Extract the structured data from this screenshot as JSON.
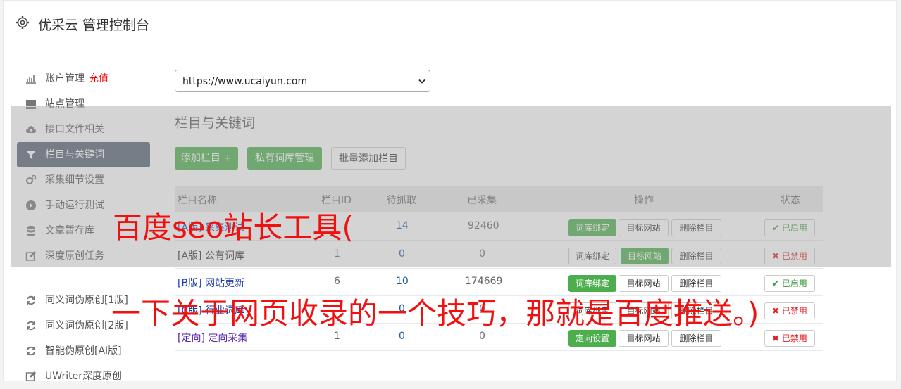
{
  "app": {
    "title": "优采云 管理控制台"
  },
  "sidebar": {
    "items": [
      {
        "label": "账户管理",
        "extra": "充值",
        "icon": "bar-chart-icon"
      },
      {
        "label": "站点管理",
        "icon": "server-icon"
      },
      {
        "label": "接口文件相关",
        "icon": "cloud-upload-icon"
      },
      {
        "label": "栏目与关键词",
        "icon": "filter-icon",
        "active": true
      },
      {
        "label": "采集细节设置",
        "icon": "cogs-icon"
      },
      {
        "label": "手动运行测试",
        "icon": "play-circle-icon"
      },
      {
        "label": "文章暂存库",
        "icon": "database-icon"
      },
      {
        "label": "深度原创任务",
        "icon": "edit-icon"
      }
    ],
    "tools": [
      {
        "label": "同义词伪原创[1版]",
        "icon": "refresh-icon"
      },
      {
        "label": "同义词伪原创[2版]",
        "icon": "refresh-icon"
      },
      {
        "label": "智能伪原创[AI版]",
        "icon": "refresh-icon"
      },
      {
        "label": "UWriter深度原创",
        "icon": "edit-icon"
      }
    ]
  },
  "site_select": {
    "value": "https://www.ucaiyun.com"
  },
  "section": {
    "title": "栏目与关键词",
    "add_button": "添加栏目 +",
    "private_lib_button": "私有词库管理",
    "batch_add_button": "批量添加栏目"
  },
  "table": {
    "headers": {
      "name": "栏目名称",
      "id": "栏目ID",
      "pending": "待抓取",
      "collected": "已采集",
      "ops": "操作",
      "status": "状态"
    },
    "rows": [
      {
        "tag": "[A版]",
        "name": "采集测试",
        "id": "",
        "pending": "14",
        "collected": "92460",
        "bind": "词库绑定",
        "target": "目标网站",
        "delete": "删除栏目",
        "status": "已启用"
      },
      {
        "tag": "[A版]",
        "name": "公有词库",
        "id": "1",
        "pending": "0",
        "collected": "0",
        "bind": "词库绑定",
        "target": "目标网站",
        "delete": "删除栏目",
        "status": "已禁用"
      },
      {
        "tag": "[B版]",
        "name": "网站更新",
        "id": "6",
        "pending": "10",
        "collected": "174669",
        "bind": "词库绑定",
        "target": "目标网站",
        "delete": "删除栏目",
        "status": "已启用"
      },
      {
        "tag": "[C版]",
        "name": "行业词库",
        "id": "",
        "pending": "0",
        "collected": "0",
        "bind": "词库绑定",
        "target": "目标网站",
        "delete": "删除栏目",
        "status": "已禁用"
      },
      {
        "tag": "[定向]",
        "name": "定向采集",
        "id": "1",
        "pending": "0",
        "collected": "0",
        "bind": "定向设置",
        "target": "目标网站",
        "delete": "删除栏目",
        "status": "已禁用"
      }
    ]
  },
  "watermark": {
    "line1": "百度seo站长工具(",
    "line2": "一下关于网页收录的一个技巧，那就是百度推送。)"
  },
  "colors": {
    "primary_green": "#4cae4c",
    "active_sidebar": "#566273",
    "watermark_red": "#f01010"
  }
}
